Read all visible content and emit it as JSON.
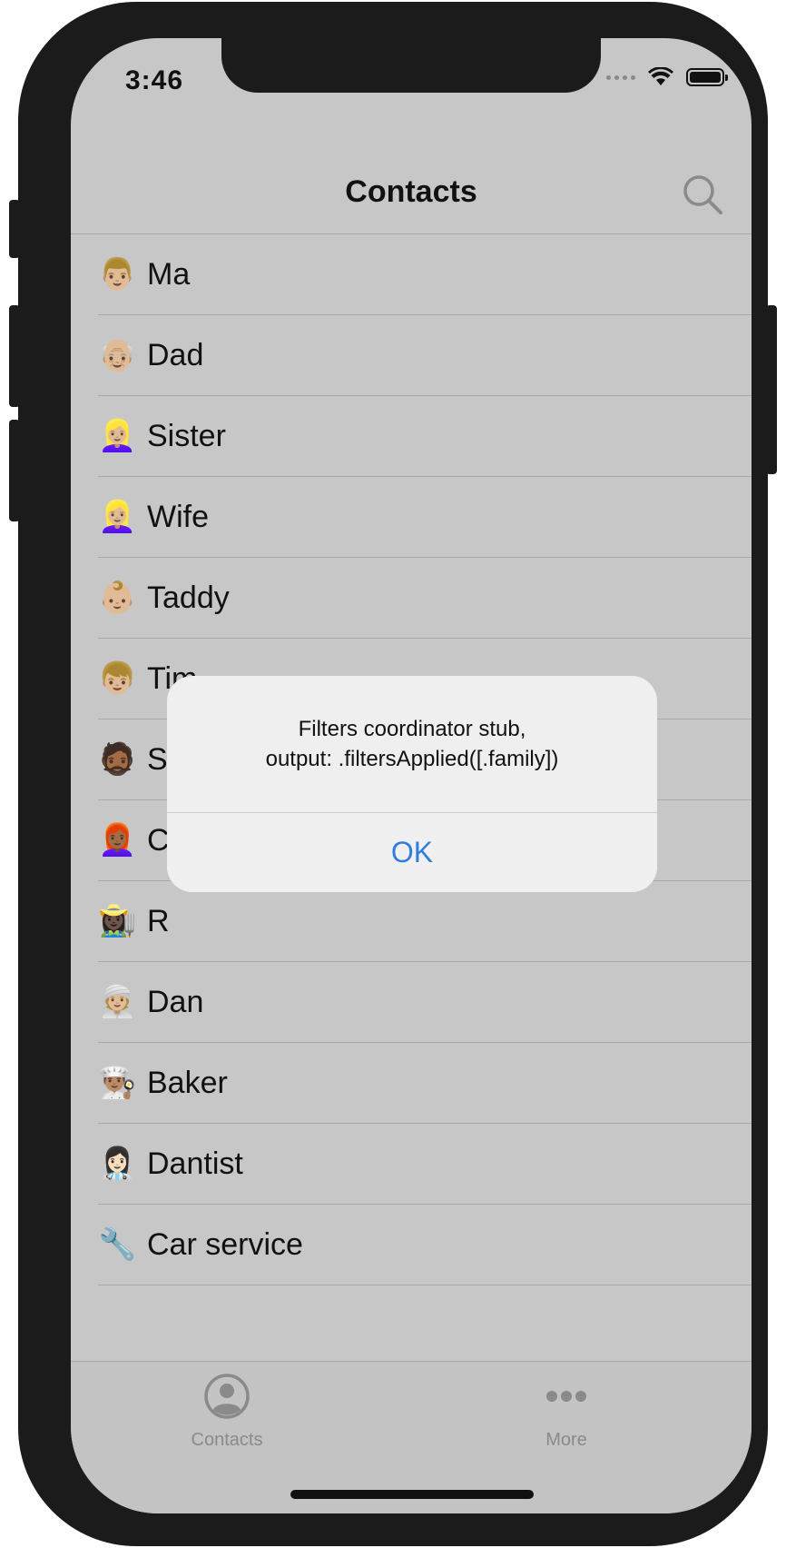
{
  "status_bar": {
    "time": "3:46"
  },
  "nav": {
    "title": "Contacts",
    "search_icon": "search-icon"
  },
  "contacts": [
    {
      "emoji": "👨🏼",
      "name": "Ma"
    },
    {
      "emoji": "👴🏼",
      "name": "Dad"
    },
    {
      "emoji": "👱🏼‍♀️",
      "name": "Sister"
    },
    {
      "emoji": "👱🏼‍♀️",
      "name": "Wife"
    },
    {
      "emoji": "👶🏼",
      "name": "Taddy"
    },
    {
      "emoji": "👦🏼",
      "name": "Tim"
    },
    {
      "emoji": "🧔🏾",
      "name": "S"
    },
    {
      "emoji": "👩🏾‍🦰",
      "name": "C"
    },
    {
      "emoji": "👩🏿‍🌾",
      "name": "R"
    },
    {
      "emoji": "👳🏼",
      "name": "Dan"
    },
    {
      "emoji": "👨🏽‍🍳",
      "name": "Baker"
    },
    {
      "emoji": "👩🏻‍⚕️",
      "name": "Dantist"
    },
    {
      "emoji": "🔧",
      "name": "Car service"
    },
    {
      "emoji": "",
      "name": ""
    }
  ],
  "alert": {
    "message_line1": "Filters coordinator stub,",
    "message_line2": "output: .filtersApplied([.family])",
    "ok_label": "OK"
  },
  "tabbar": {
    "contacts_label": "Contacts",
    "more_label": "More"
  },
  "colors": {
    "accent": "#2f7de1",
    "background_dimmed": "#c7c7c7",
    "tab_inactive": "#8a8a8a"
  }
}
